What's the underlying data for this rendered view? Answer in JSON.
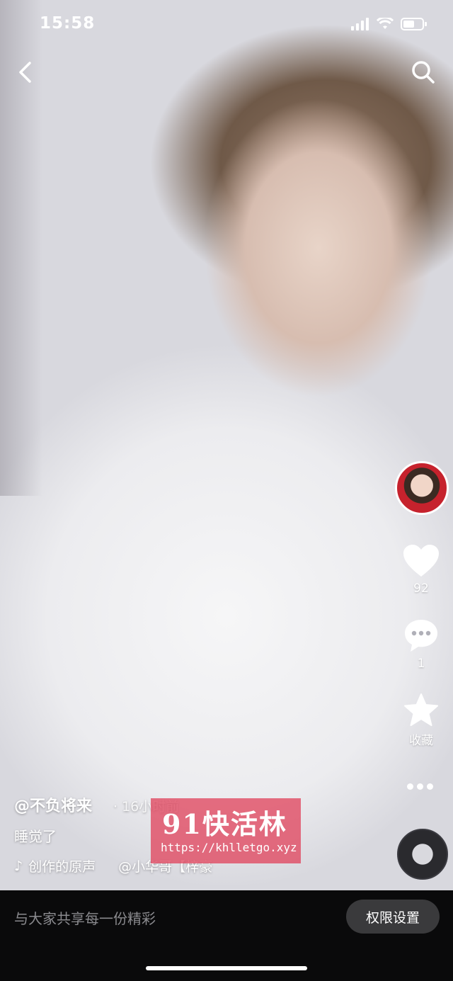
{
  "status_bar": {
    "time": "15:58"
  },
  "top_bar": {
    "back_icon": "chevron-left-icon",
    "search_icon": "search-icon"
  },
  "side_actions": {
    "likes": {
      "icon": "heart-icon",
      "count": "92"
    },
    "comments": {
      "icon": "comment-icon",
      "count": "1"
    },
    "favorite": {
      "icon": "star-icon",
      "label": "收藏"
    },
    "more_icon": "more-dots-icon"
  },
  "post": {
    "author": "@不负将来",
    "time_ago": "· 16小时前",
    "caption": "睡觉了",
    "music_note": "♪",
    "music_title": "创作的原声",
    "music_credit": "@小华哥【梓豪"
  },
  "watermark": {
    "title": "91快活林",
    "url": "https://khlletgo.xyz"
  },
  "bottom_bar": {
    "share_text": "与大家共享每一份精彩",
    "permission_button": "权限设置"
  },
  "colors": {
    "watermark_bg": "#e0465f",
    "bottom_bg": "#0a0a0b",
    "button_bg": "#3a3a3c"
  }
}
